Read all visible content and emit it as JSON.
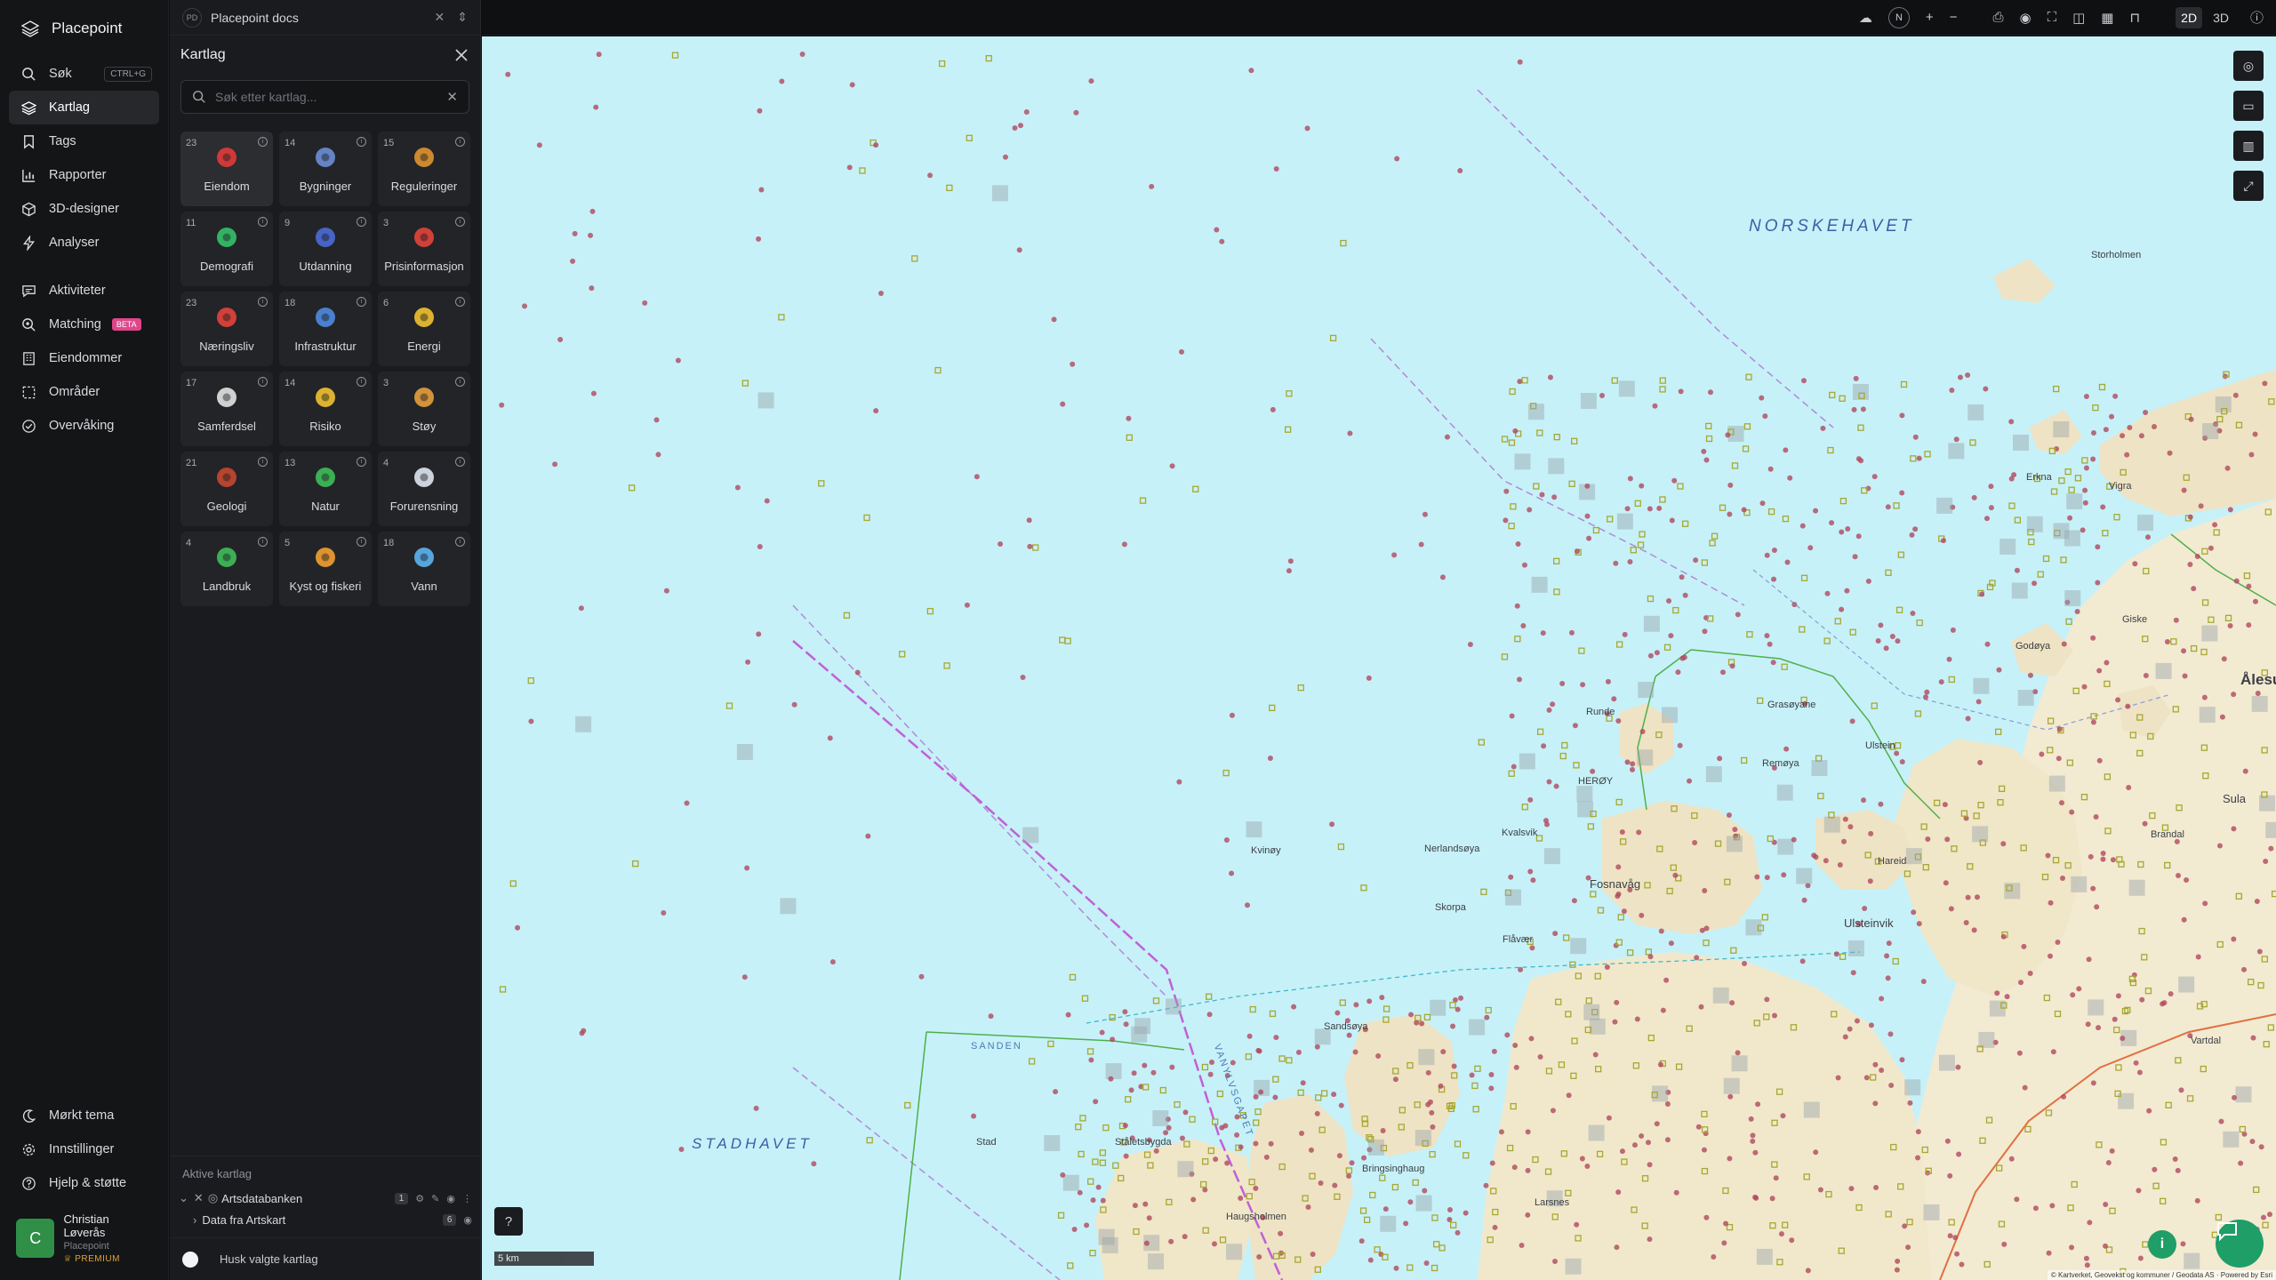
{
  "app": {
    "name": "Placepoint"
  },
  "nav": {
    "items": [
      {
        "label": "Søk",
        "shortcut": "CTRL+G"
      },
      {
        "label": "Kartlag"
      },
      {
        "label": "Tags"
      },
      {
        "label": "Rapporter"
      },
      {
        "label": "3D-designer"
      },
      {
        "label": "Analyser"
      },
      {
        "label": "Aktiviteter"
      },
      {
        "label": "Matching",
        "badge": "BETA"
      },
      {
        "label": "Eiendommer"
      },
      {
        "label": "Områder"
      },
      {
        "label": "Overvåking"
      }
    ],
    "bottom": [
      {
        "label": "Mørkt tema"
      },
      {
        "label": "Innstillinger"
      },
      {
        "label": "Hjelp & støtte"
      }
    ],
    "user": {
      "initial": "C",
      "name": "Christian Løverås",
      "org": "Placepoint",
      "plan": "PREMIUM"
    }
  },
  "tab": {
    "badge": "PD",
    "title": "Placepoint docs"
  },
  "panel": {
    "title": "Kartlag",
    "search_placeholder": "Søk etter kartlag...",
    "tiles": [
      {
        "count": "23",
        "label": "Eiendom",
        "icon": "pin-house-icon",
        "color": "#e23b3b"
      },
      {
        "count": "14",
        "label": "Bygninger",
        "icon": "building-icon",
        "color": "#6b8fd6"
      },
      {
        "count": "15",
        "label": "Reguleringer",
        "icon": "signpost-icon",
        "color": "#e0952f"
      },
      {
        "count": "11",
        "label": "Demografi",
        "icon": "demography-icon",
        "color": "#35c26a"
      },
      {
        "count": "9",
        "label": "Utdanning",
        "icon": "graduation-icon",
        "color": "#4d6bd6"
      },
      {
        "count": "3",
        "label": "Prisinformasjon",
        "icon": "shopping-bag-icon",
        "color": "#e5443c"
      },
      {
        "count": "23",
        "label": "Næringsliv",
        "icon": "briefcase-icon",
        "color": "#e5443c"
      },
      {
        "count": "18",
        "label": "Infrastruktur",
        "icon": "globe-icon",
        "color": "#4f8be0"
      },
      {
        "count": "6",
        "label": "Energi",
        "icon": "lightning-icon",
        "color": "#f2c230"
      },
      {
        "count": "17",
        "label": "Samferdsel",
        "icon": "train-icon",
        "color": "#e3e3e3"
      },
      {
        "count": "14",
        "label": "Risiko",
        "icon": "hazard-icon",
        "color": "#f2c230"
      },
      {
        "count": "3",
        "label": "Støy",
        "icon": "gauge-icon",
        "color": "#e5a03c"
      },
      {
        "count": "21",
        "label": "Geologi",
        "icon": "terrain-icon",
        "color": "#c7482f"
      },
      {
        "count": "13",
        "label": "Natur",
        "icon": "leaf-icon",
        "color": "#3fbf5a"
      },
      {
        "count": "4",
        "label": "Forurensning",
        "icon": "factory-icon",
        "color": "#dfe6ef"
      },
      {
        "count": "4",
        "label": "Landbruk",
        "icon": "sprout-icon",
        "color": "#3fbf5a"
      },
      {
        "count": "5",
        "label": "Kyst og fiskeri",
        "icon": "fish-icon",
        "color": "#f2a030"
      },
      {
        "count": "18",
        "label": "Vann",
        "icon": "drop-icon",
        "color": "#5db4ef"
      }
    ],
    "active_title": "Aktive kartlag",
    "active_layers": [
      {
        "label": "Artsdatabanken",
        "count": "1"
      },
      {
        "label": "Data fra Artskart",
        "count": "6"
      }
    ],
    "remember_label": "Husk valgte kartlag"
  },
  "topbar": {
    "compass": "N",
    "plus": "+",
    "minus": "−",
    "mode_2d": "2D",
    "mode_3d": "3D"
  },
  "map": {
    "sea_labels": [
      "NORSKEHAVET",
      "STADHAVET"
    ],
    "places": [
      "Storholmen",
      "Erkna",
      "Vigra",
      "Giske",
      "Godøya",
      "Ålesund",
      "Runde",
      "HERØY",
      "Grasøyane",
      "Remøya",
      "Fosnavåg",
      "Kvalsvik",
      "Nerlandsøya",
      "Skorpa",
      "Flåvær",
      "Sandsøya",
      "Stad",
      "Ståletsbygda",
      "Bringsinghaug",
      "Haugsholmen",
      "Larsnes",
      "Hareid",
      "Brandal",
      "Ulstein",
      "Ulsteinvik",
      "Sula",
      "Kvinøy",
      "SANDEN",
      "VANYLVSGAPET",
      "Vartdal"
    ],
    "scale": "5 km",
    "attribution": "© Kartverket, Geovekst og kommuner / Geodata AS · Powered by Esri"
  }
}
